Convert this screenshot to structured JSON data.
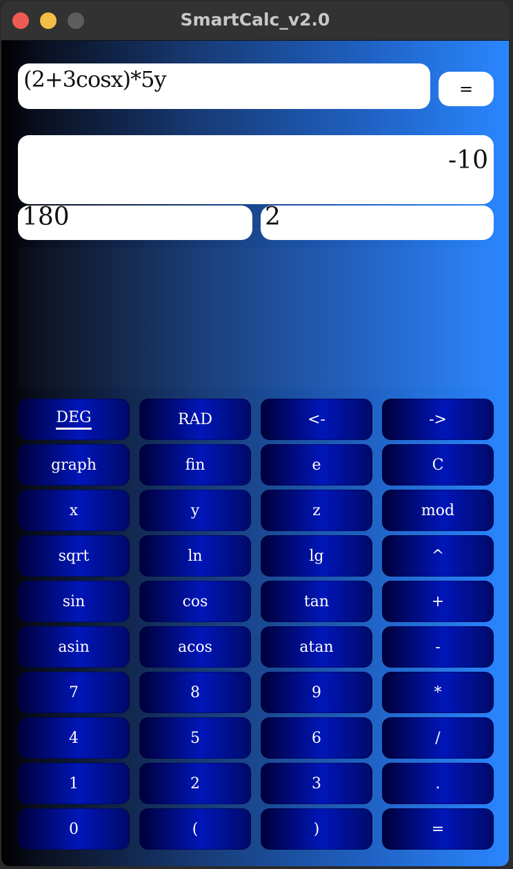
{
  "window": {
    "title": "SmartCalc_v2.0"
  },
  "expression": "(2+3cosx)*5y",
  "equals_top": "=",
  "result": "-10",
  "x_value": "180",
  "y_value": "2",
  "keys": [
    [
      "DEG",
      "RAD",
      "<-",
      "->"
    ],
    [
      "graph",
      "fin",
      "e",
      "C"
    ],
    [
      "x",
      "y",
      "z",
      "mod"
    ],
    [
      "sqrt",
      "ln",
      "lg",
      "^"
    ],
    [
      "sin",
      "cos",
      "tan",
      "+"
    ],
    [
      "asin",
      "acos",
      "atan",
      "-"
    ],
    [
      "7",
      "8",
      "9",
      "*"
    ],
    [
      "4",
      "5",
      "6",
      "/"
    ],
    [
      "1",
      "2",
      "3",
      "."
    ],
    [
      "0",
      "(",
      ")",
      "="
    ]
  ],
  "active_key": "DEG"
}
